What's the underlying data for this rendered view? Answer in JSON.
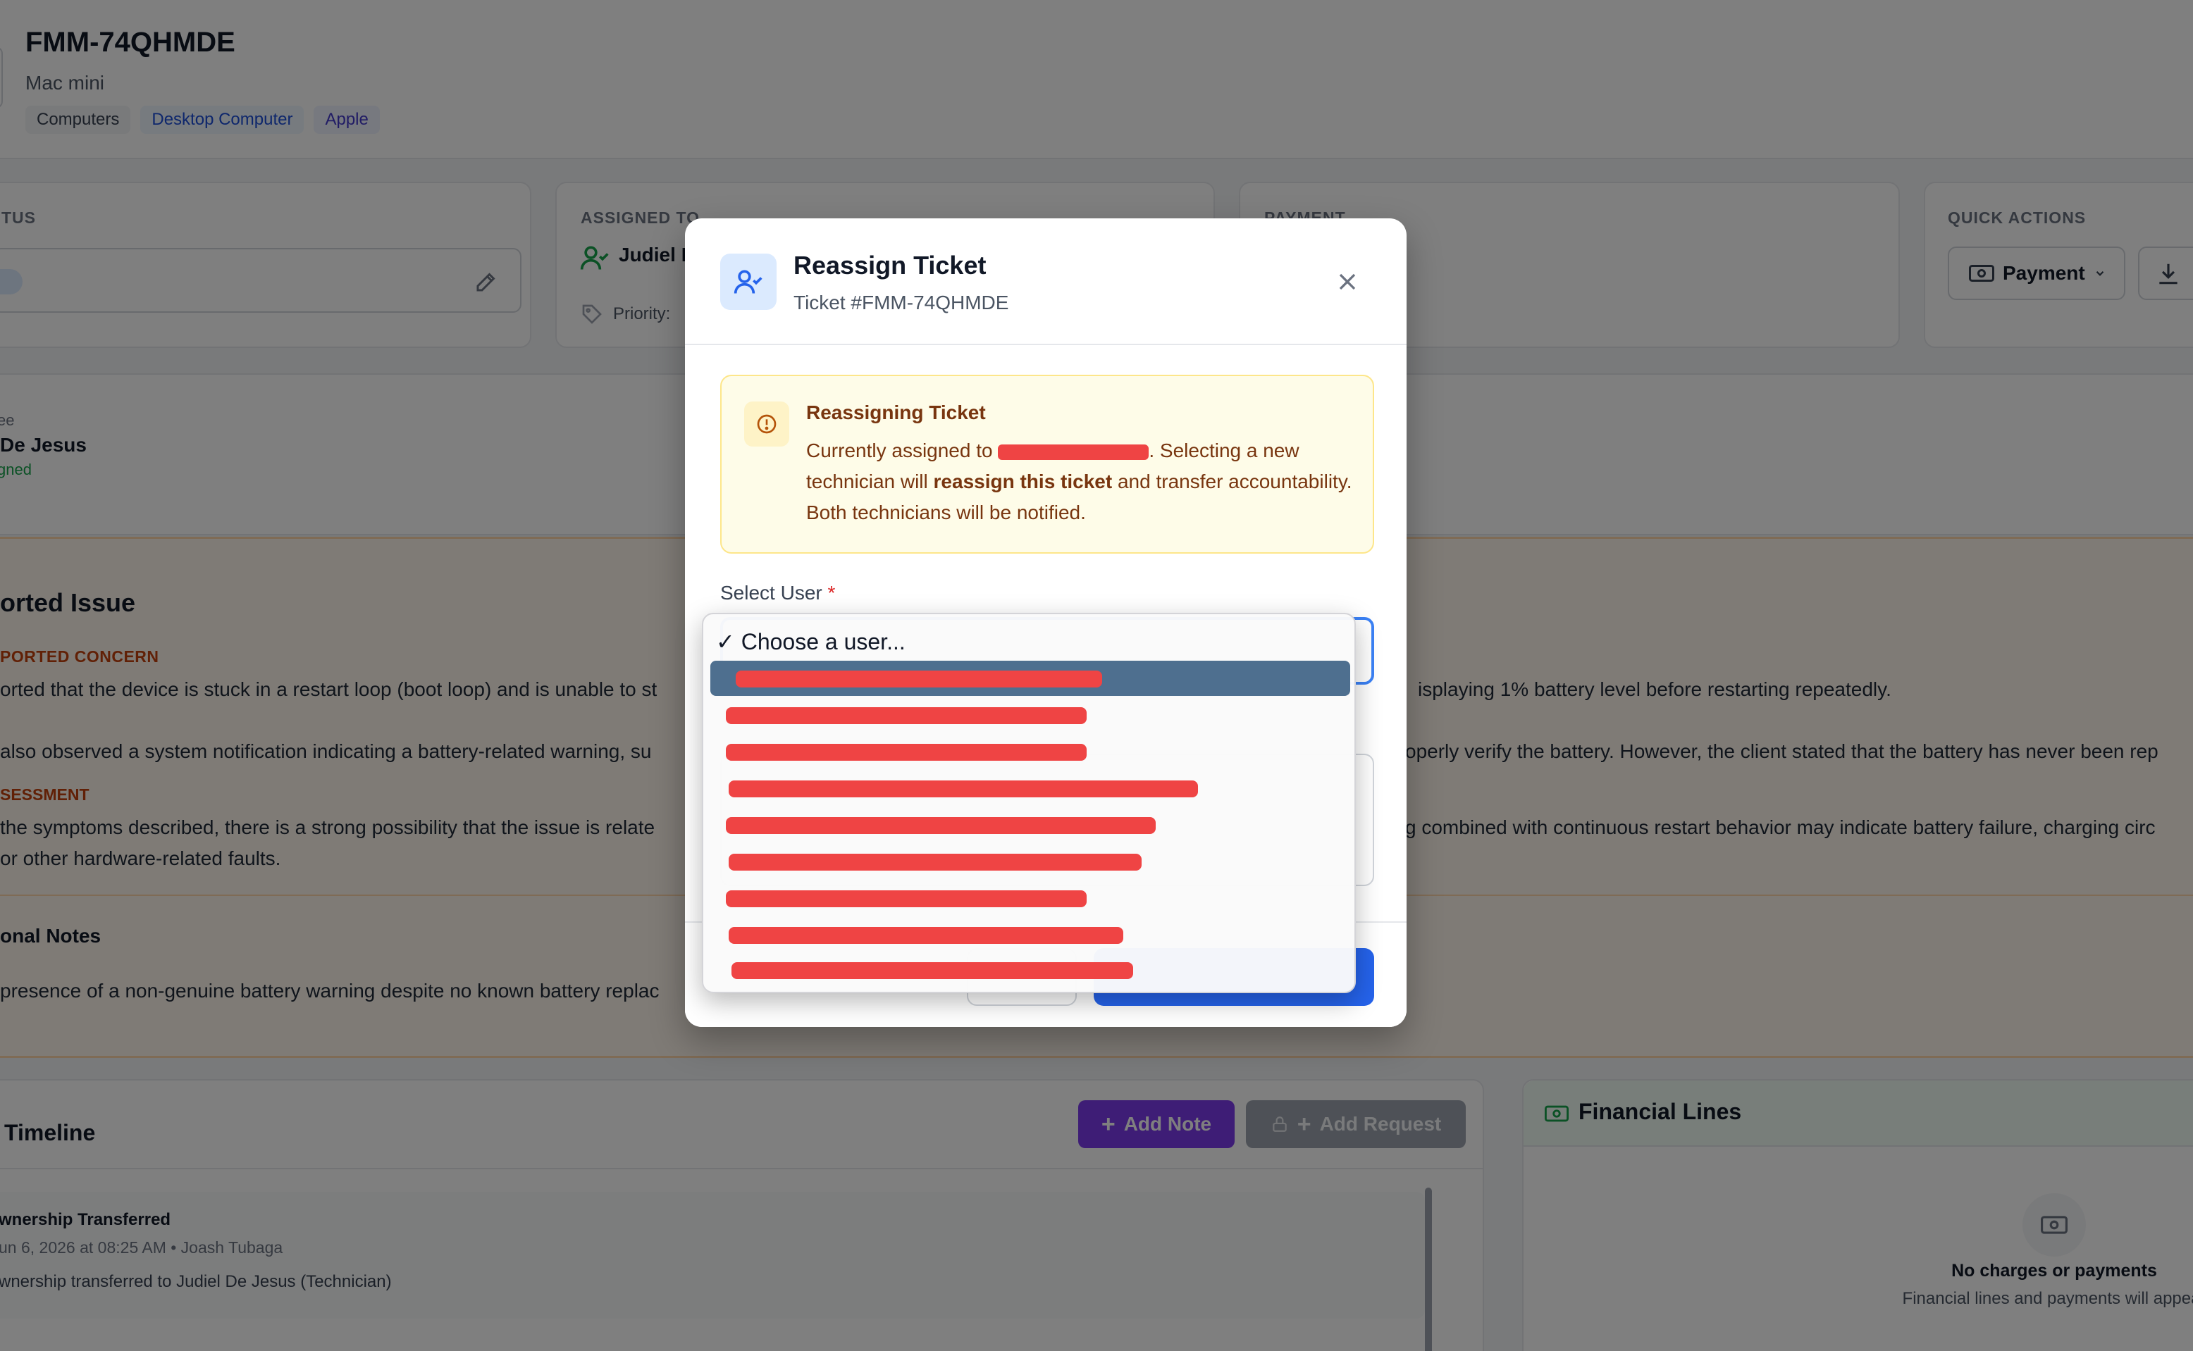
{
  "ticket": {
    "id": "FMM-74QHMDE",
    "device": "Mac mini",
    "tags": [
      "Computers",
      "Desktop Computer",
      "Apple"
    ]
  },
  "cards": {
    "status_label": "TUS",
    "assigned_label": "ASSIGNED TO",
    "assigned_name": "Judiel D",
    "priority_label": "Priority:",
    "payment_label": "PAYMENT",
    "quick_actions_label": "QUICK ACTIONS",
    "payment_button": "Payment"
  },
  "assignee": {
    "role": "ee",
    "name": "De Jesus",
    "status": "gned"
  },
  "issue": {
    "title": "orted Issue",
    "concern_label": "PORTED CONCERN",
    "concern_line1a": "orted that the device is stuck in a restart loop (boot loop) and is unable to st",
    "concern_line1b": "isplaying 1% battery level before restarting repeatedly.",
    "concern_line2a": "also observed a system notification indicating a battery-related warning, su",
    "concern_line2b": "operly verify the battery. However, the client stated that the battery has never been rep",
    "assessment_label": "SESSMENT",
    "assessment_line1a": "the symptoms described, there is a strong possibility that the issue is relate",
    "assessment_line1b": "g combined with continuous restart behavior may indicate battery failure, charging circ",
    "assessment_line2": "or other hardware-related faults.",
    "notes_title": "onal Notes",
    "notes_line": "presence of a non-genuine battery warning despite no known battery replac"
  },
  "timeline": {
    "title": "Timeline",
    "add_note": "Add Note",
    "add_request": "Add Request",
    "entry_title": "wnership Transferred",
    "entry_meta": "un 6, 2026 at 08:25 AM • Joash Tubaga",
    "entry_text": "wnership transferred to Judiel De Jesus (Technician)"
  },
  "financial": {
    "title": "Financial Lines",
    "empty_title": "No charges or payments",
    "empty_sub": "Financial lines and payments will appear"
  },
  "modal": {
    "title": "Reassign Ticket",
    "subtitle": "Ticket #FMM-74QHMDE",
    "warning_title": "Reassigning Ticket",
    "warning_pre": "Currently assigned to ",
    "warning_mid": ". Selecting a new technician will ",
    "warning_bold": "reassign this ticket",
    "warning_post": " and transfer accountability. Both technicians will be notified.",
    "select_label": "Select User",
    "required_mark": "*"
  },
  "dropdown": {
    "placeholder": "✓ Choose a user...",
    "redacted_option_count": 9
  },
  "colors": {
    "primary": "#2563eb",
    "purple": "#7c3aed",
    "warning_bg": "#fefce8",
    "redaction": "#ef4444",
    "selected_option": "#4e6f8f"
  }
}
